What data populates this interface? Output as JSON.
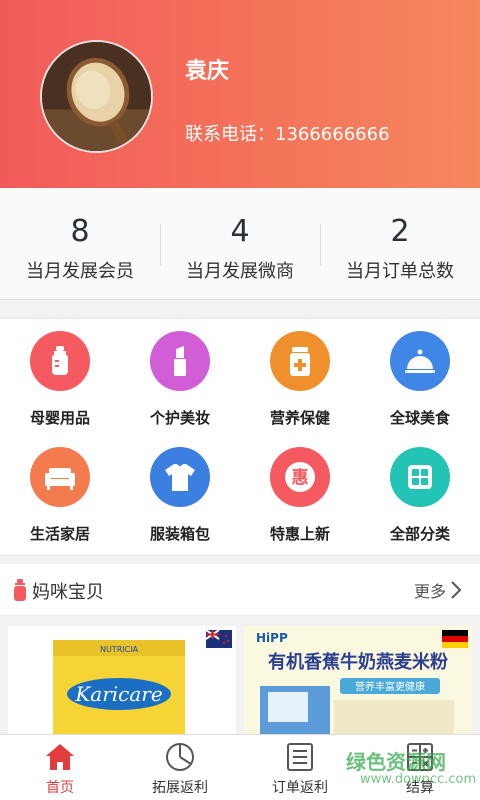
{
  "profile": {
    "name": "袁庆",
    "phone": "联系电话：1366666666"
  },
  "stats": [
    {
      "value": "8",
      "label": "当月发展会员"
    },
    {
      "value": "4",
      "label": "当月发展微商"
    },
    {
      "value": "2",
      "label": "当月订单总数"
    }
  ],
  "categories": [
    {
      "label": "母婴用品",
      "icon": "baby-bottle-icon",
      "color": "#f45a5f"
    },
    {
      "label": "个护美妆",
      "icon": "lipstick-icon",
      "color": "#d25ed7"
    },
    {
      "label": "营养保健",
      "icon": "supplement-jar-icon",
      "color": "#f0902c"
    },
    {
      "label": "全球美食",
      "icon": "food-cloche-icon",
      "color": "#3f86e6"
    },
    {
      "label": "生活家居",
      "icon": "sofa-icon",
      "color": "#f47b4e"
    },
    {
      "label": "服装箱包",
      "icon": "tshirt-icon",
      "color": "#3b7fe0"
    },
    {
      "label": "特惠上新",
      "icon": "discount-badge-icon",
      "color": "#f45a5f"
    },
    {
      "label": "全部分类",
      "icon": "grid-icon",
      "color": "#23c3b6"
    }
  ],
  "section": {
    "title": "妈咪宝贝",
    "more": "更多"
  },
  "products": [
    {
      "brand": "Karicare",
      "maker": "NUTRICIA"
    },
    {
      "brand": "HiPP",
      "title": "有机香蕉牛奶燕麦米粉",
      "tagline": "营养丰富更健康"
    }
  ],
  "tabs": [
    {
      "label": "首页",
      "active": true
    },
    {
      "label": "拓展返利",
      "active": false
    },
    {
      "label": "订单返利",
      "active": false
    },
    {
      "label": "结算",
      "active": false
    }
  ],
  "watermark": {
    "main": "绿色资源网",
    "sub": "www.downcc.com"
  },
  "colors": {
    "accent": "#e23c3c",
    "header_start": "#f25a5a",
    "header_end": "#f5875c"
  }
}
